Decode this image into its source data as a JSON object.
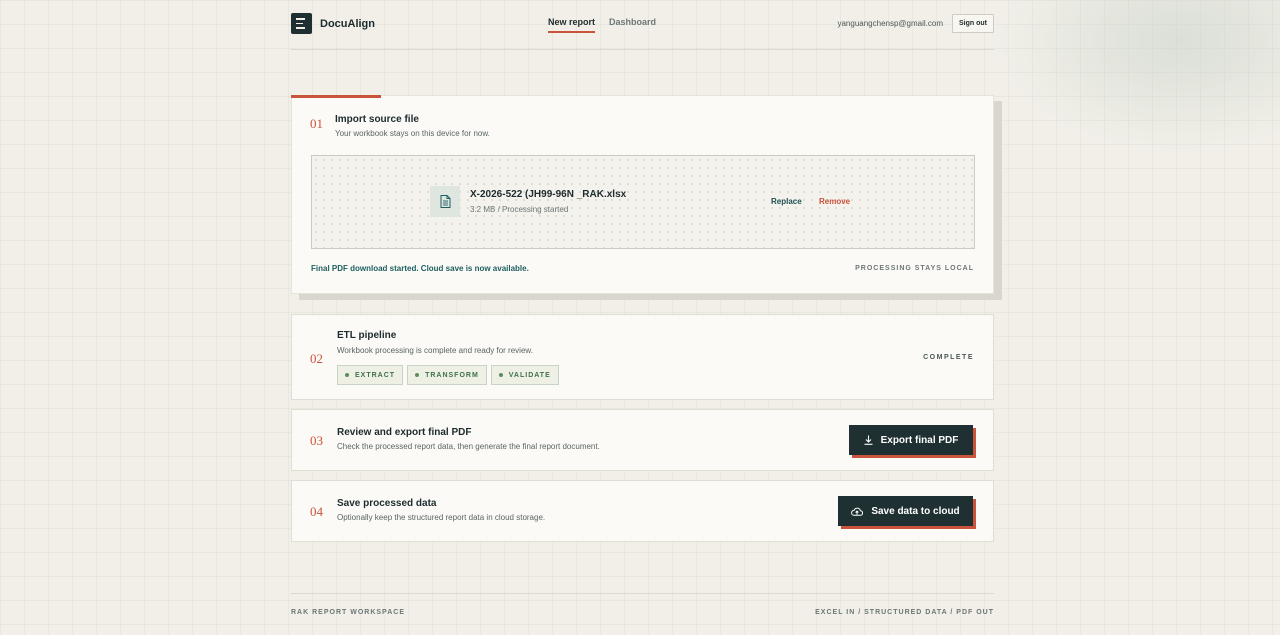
{
  "app": {
    "name": "DocuAlign"
  },
  "nav": {
    "items": [
      {
        "label": "New report",
        "active": true
      },
      {
        "label": "Dashboard",
        "active": false
      }
    ]
  },
  "account": {
    "email": "yanguangchensp@gmail.com",
    "signout_label": "Sign out"
  },
  "steps": [
    {
      "number": "01",
      "title": "Import source file",
      "subtitle": "Your workbook stays on this device for now.",
      "file": {
        "name": "X-2026-522 (JH99-96N _RAK.xlsx",
        "meta": "3.2 MB / Processing started",
        "icon": "document-icon"
      },
      "replace_label": "Replace",
      "remove_label": "Remove",
      "status_message": "Final PDF download started. Cloud save is now available.",
      "tag": "PROCESSING STAYS LOCAL"
    },
    {
      "number": "02",
      "title": "ETL pipeline",
      "subtitle": "Workbook processing is complete and ready for review.",
      "chips": [
        "EXTRACT",
        "TRANSFORM",
        "VALIDATE"
      ],
      "status": "COMPLETE"
    },
    {
      "number": "03",
      "title": "Review and export final PDF",
      "subtitle": "Check the processed report data, then generate the final report document.",
      "button_label": "Export final PDF",
      "button_icon": "download-icon"
    },
    {
      "number": "04",
      "title": "Save processed data",
      "subtitle": "Optionally keep the structured report data in cloud storage.",
      "button_label": "Save data to cloud",
      "button_icon": "cloud-upload-icon"
    }
  ],
  "footer": {
    "left": "RAK REPORT WORKSPACE",
    "right": "EXCEL IN / STRUCTURED DATA / PDF OUT"
  },
  "colors": {
    "accent": "#c9533b",
    "dark": "#1f3033",
    "success": "#3f7048",
    "background": "#f1efe8"
  }
}
